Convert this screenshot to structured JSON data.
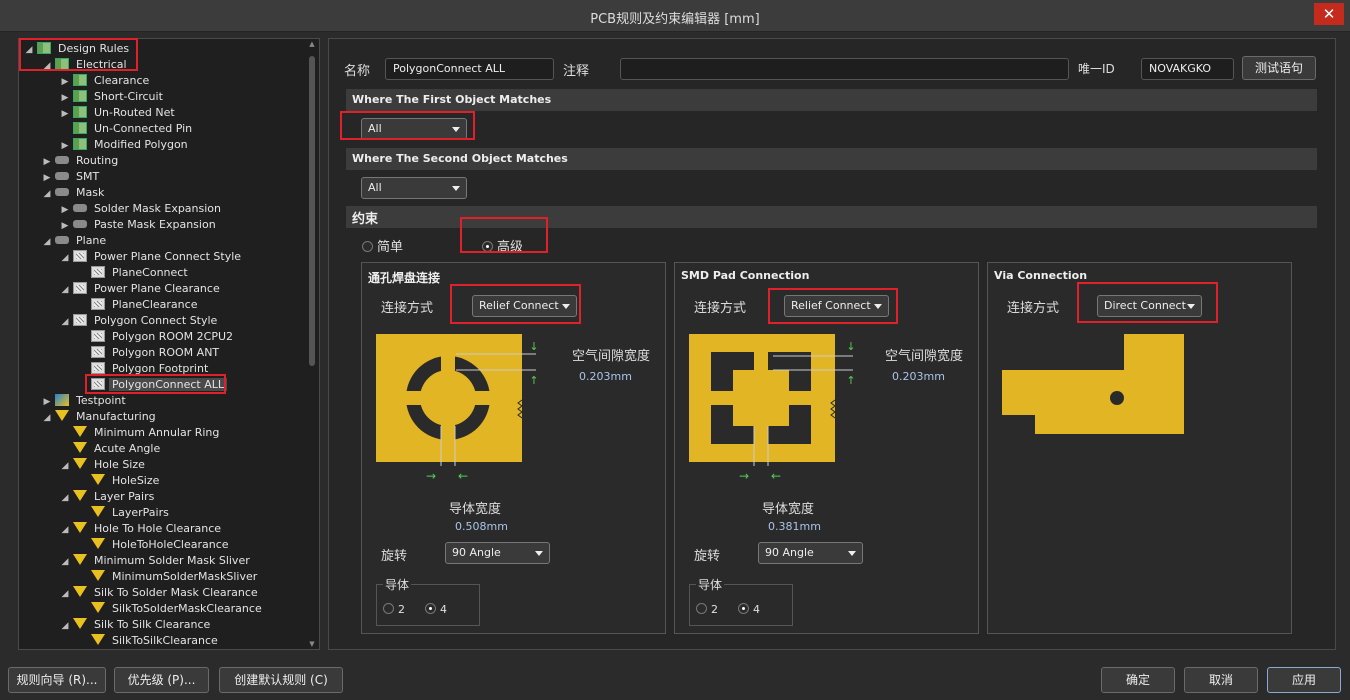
{
  "window": {
    "title": "PCB规则及约束编辑器 [mm]"
  },
  "tree": [
    {
      "label": "Design Rules",
      "level": 0,
      "toggle": "▲",
      "icon": "folder-rules-icon"
    },
    {
      "label": "Electrical",
      "level": 1,
      "toggle": "▲",
      "icon": "class-icon"
    },
    {
      "label": "Clearance",
      "level": 2,
      "toggle": "▶",
      "icon": "class-icon"
    },
    {
      "label": "Short-Circuit",
      "level": 2,
      "toggle": "▶",
      "icon": "class-icon"
    },
    {
      "label": "Un-Routed Net",
      "level": 2,
      "toggle": "▶",
      "icon": "class-icon"
    },
    {
      "label": "Un-Connected Pin",
      "level": 2,
      "toggle": "",
      "icon": "class-icon"
    },
    {
      "label": "Modified Polygon",
      "level": 2,
      "toggle": "▶",
      "icon": "class-icon"
    },
    {
      "label": "Routing",
      "level": 1,
      "toggle": "▶",
      "icon": "routing-icon"
    },
    {
      "label": "SMT",
      "level": 1,
      "toggle": "▶",
      "icon": "smt-icon"
    },
    {
      "label": "Mask",
      "level": 1,
      "toggle": "▲",
      "icon": "mask-icon"
    },
    {
      "label": "Solder Mask Expansion",
      "level": 2,
      "toggle": "▶",
      "icon": "mask-icon"
    },
    {
      "label": "Paste Mask Expansion",
      "level": 2,
      "toggle": "▶",
      "icon": "mask-icon"
    },
    {
      "label": "Plane",
      "level": 1,
      "toggle": "▲",
      "icon": "plane-icon"
    },
    {
      "label": "Power Plane Connect Style",
      "level": 2,
      "toggle": "▲",
      "icon": "rule-icon"
    },
    {
      "label": "PlaneConnect",
      "level": 3,
      "toggle": "",
      "icon": "rule-icon"
    },
    {
      "label": "Power Plane Clearance",
      "level": 2,
      "toggle": "▲",
      "icon": "rule-icon"
    },
    {
      "label": "PlaneClearance",
      "level": 3,
      "toggle": "",
      "icon": "rule-icon"
    },
    {
      "label": "Polygon Connect Style",
      "level": 2,
      "toggle": "▲",
      "icon": "rule-icon"
    },
    {
      "label": "Polygon ROOM 2CPU2",
      "level": 3,
      "toggle": "",
      "icon": "rule-icon"
    },
    {
      "label": "Polygon ROOM ANT",
      "level": 3,
      "toggle": "",
      "icon": "rule-icon"
    },
    {
      "label": "Polygon Footprint",
      "level": 3,
      "toggle": "",
      "icon": "rule-icon"
    },
    {
      "label": "PolygonConnect ALL",
      "level": 3,
      "toggle": "",
      "icon": "rule-icon",
      "selected": true
    },
    {
      "label": "Testpoint",
      "level": 1,
      "toggle": "▶",
      "icon": "testpoint-icon"
    },
    {
      "label": "Manufacturing",
      "level": 1,
      "toggle": "▲",
      "icon": "mfg-icon"
    },
    {
      "label": "Minimum Annular Ring",
      "level": 2,
      "toggle": "",
      "icon": "mfg-icon"
    },
    {
      "label": "Acute Angle",
      "level": 2,
      "toggle": "",
      "icon": "mfg-icon"
    },
    {
      "label": "Hole Size",
      "level": 2,
      "toggle": "▲",
      "icon": "mfg-icon"
    },
    {
      "label": "HoleSize",
      "level": 3,
      "toggle": "",
      "icon": "mfg-icon"
    },
    {
      "label": "Layer Pairs",
      "level": 2,
      "toggle": "▲",
      "icon": "mfg-icon"
    },
    {
      "label": "LayerPairs",
      "level": 3,
      "toggle": "",
      "icon": "mfg-icon"
    },
    {
      "label": "Hole To Hole Clearance",
      "level": 2,
      "toggle": "▲",
      "icon": "mfg-icon"
    },
    {
      "label": "HoleToHoleClearance",
      "level": 3,
      "toggle": "",
      "icon": "mfg-icon"
    },
    {
      "label": "Minimum Solder Mask Sliver",
      "level": 2,
      "toggle": "▲",
      "icon": "mfg-icon"
    },
    {
      "label": "MinimumSolderMaskSliver",
      "level": 3,
      "toggle": "",
      "icon": "mfg-icon"
    },
    {
      "label": "Silk To Solder Mask Clearance",
      "level": 2,
      "toggle": "▲",
      "icon": "mfg-icon"
    },
    {
      "label": "SilkToSolderMaskClearance",
      "level": 3,
      "toggle": "",
      "icon": "mfg-icon"
    },
    {
      "label": "Silk To Silk Clearance",
      "level": 2,
      "toggle": "▲",
      "icon": "mfg-icon"
    },
    {
      "label": "SilkToSilkClearance",
      "level": 3,
      "toggle": "",
      "icon": "mfg-icon"
    }
  ],
  "rule": {
    "name_label": "名称",
    "name_value": "PolygonConnect ALL",
    "comment_label": "注释",
    "comment_value": "",
    "uid_label": "唯一ID",
    "uid_value": "NOVAKGKO",
    "test_button": "测试语句"
  },
  "first_match": {
    "title": "Where The First Object Matches",
    "value": "All"
  },
  "second_match": {
    "title": "Where The Second Object Matches",
    "value": "All"
  },
  "constraints": {
    "title": "约束",
    "mode_simple": "简单",
    "mode_advanced": "高级",
    "selected_mode": "advanced"
  },
  "panels": {
    "through_hole": {
      "title": "通孔焊盘连接",
      "connect_label": "连接方式",
      "connect_value": "Relief Connect",
      "air_gap_label": "空气间隙宽度",
      "air_gap_value": "0.203mm",
      "conductor_width_label": "导体宽度",
      "conductor_width_value": "0.508mm",
      "rotation_label": "旋转",
      "rotation_value": "90 Angle",
      "conductors_label": "导体",
      "conductor_opt1": "2",
      "conductor_opt2": "4",
      "conductors_selected": "4"
    },
    "smd": {
      "title": "SMD Pad Connection",
      "connect_label": "连接方式",
      "connect_value": "Relief Connect",
      "air_gap_label": "空气间隙宽度",
      "air_gap_value": "0.203mm",
      "conductor_width_label": "导体宽度",
      "conductor_width_value": "0.381mm",
      "rotation_label": "旋转",
      "rotation_value": "90 Angle",
      "conductors_label": "导体",
      "conductor_opt1": "2",
      "conductor_opt2": "4",
      "conductors_selected": "4"
    },
    "via": {
      "title": "Via Connection",
      "connect_label": "连接方式",
      "connect_value": "Direct Connect"
    }
  },
  "footer": {
    "wizard": "规则向导 (R)...",
    "priority": "优先级 (P)...",
    "create_default": "创建默认规则 (C)",
    "ok": "确定",
    "cancel": "取消",
    "apply": "应用"
  },
  "colors": {
    "copper": "#e2b524",
    "highlight": "#e0202a",
    "value_text": "#a8c4ea"
  }
}
